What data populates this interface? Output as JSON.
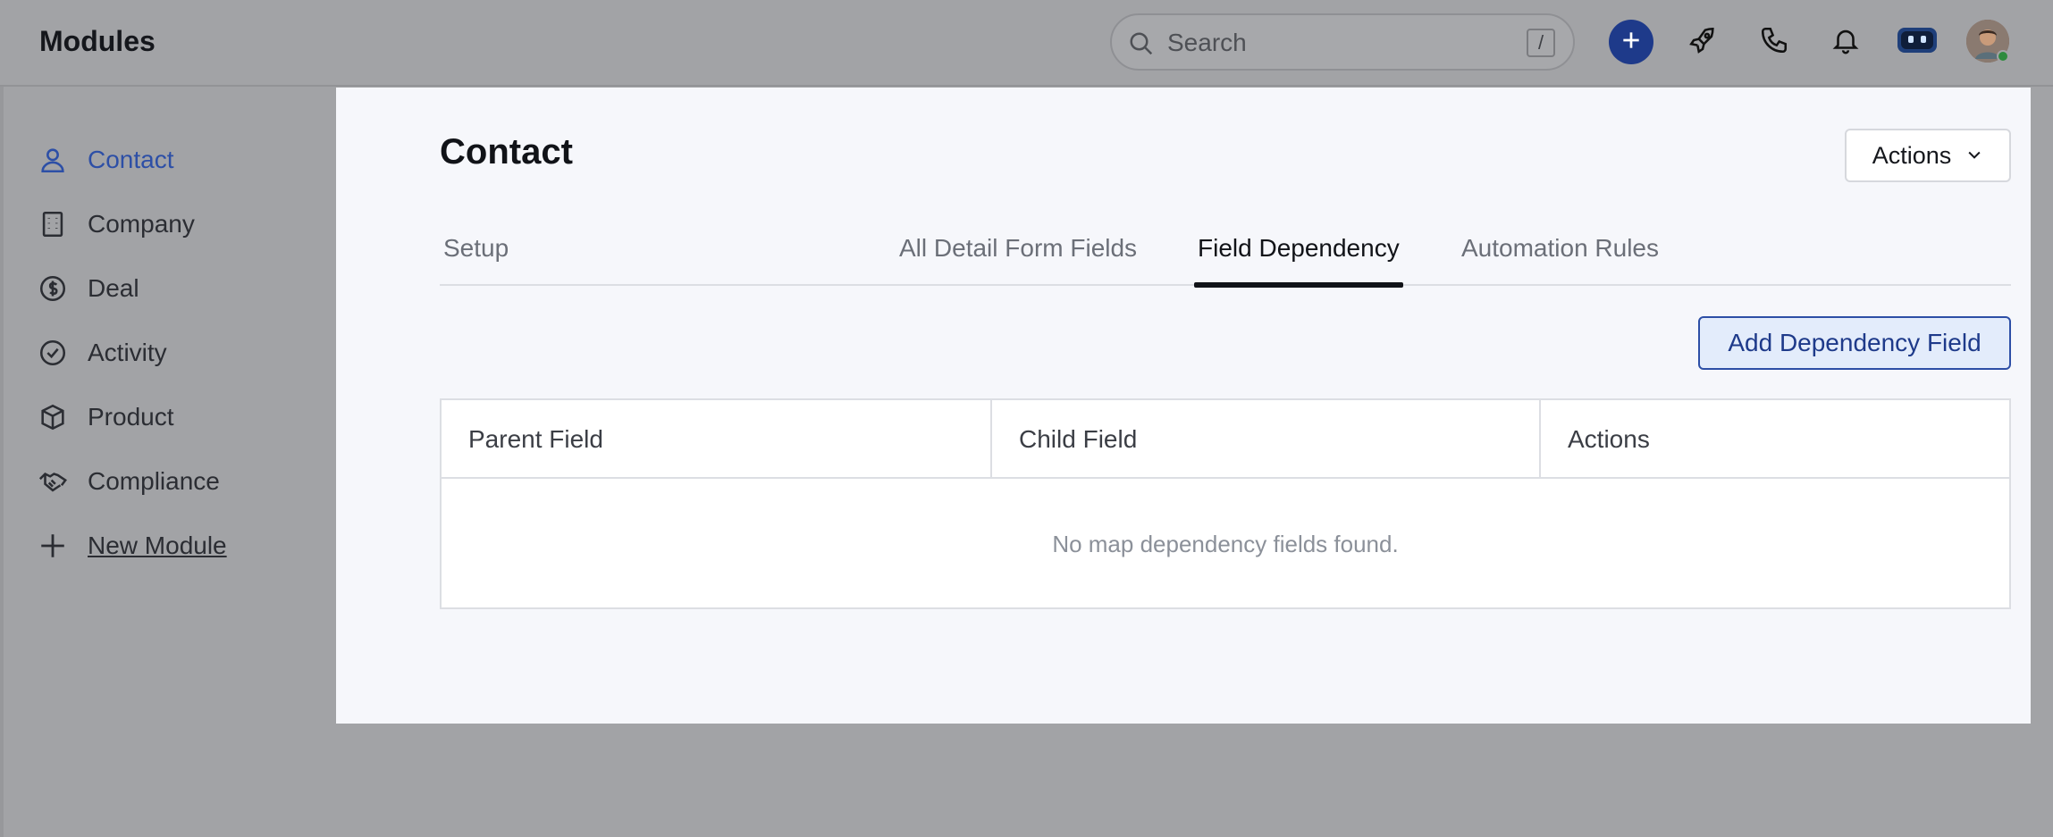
{
  "header": {
    "title": "Modules",
    "search": {
      "placeholder": "Search",
      "shortcut": "/"
    },
    "icons": [
      "plus-icon",
      "rocket-icon",
      "phone-icon",
      "bell-icon",
      "bot-icon",
      "user-avatar"
    ]
  },
  "sidebar": {
    "items": [
      {
        "label": "Contact",
        "icon": "user-icon",
        "active": true
      },
      {
        "label": "Company",
        "icon": "building-icon"
      },
      {
        "label": "Deal",
        "icon": "dollar-icon"
      },
      {
        "label": "Activity",
        "icon": "check-circle-icon"
      },
      {
        "label": "Product",
        "icon": "box-icon"
      },
      {
        "label": "Compliance",
        "icon": "handshake-icon"
      },
      {
        "label": "New Module",
        "icon": "plus-icon"
      }
    ]
  },
  "main": {
    "title": "Contact",
    "actions_label": "Actions",
    "tabs": [
      {
        "label": "Setup"
      },
      {
        "label": "All Detail Form Fields"
      },
      {
        "label": "Field Dependency",
        "active": true
      },
      {
        "label": "Automation Rules"
      }
    ],
    "add_button": "Add Dependency Field",
    "table": {
      "columns": [
        "Parent Field",
        "Child Field",
        "Actions"
      ],
      "empty_text": "No map dependency fields found."
    }
  },
  "colors": {
    "accent": "#2d4fa6",
    "overlay": "#a2a3a6",
    "panel": "#f6f7fb"
  }
}
